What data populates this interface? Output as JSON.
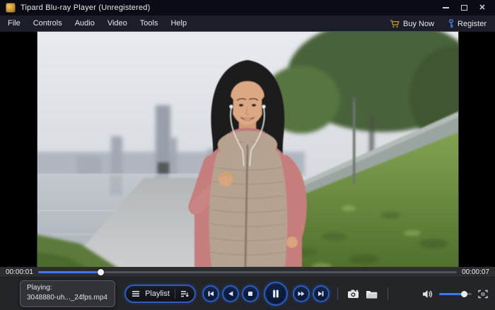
{
  "titlebar": {
    "title": "Tipard Blu-ray Player (Unregistered)"
  },
  "menubar": {
    "items": [
      "File",
      "Controls",
      "Audio",
      "Video",
      "Tools",
      "Help"
    ],
    "buy_now_label": "Buy Now",
    "register_label": "Register"
  },
  "video": {
    "description": "Woman jogging toward camera on a waterfront embankment path; hazy city skyline and tall tower across the water on the left, grassy slope with concrete retaining wall and trees on the right"
  },
  "player": {
    "current_time": "00:00:01",
    "total_time": "00:00:07",
    "progress_percent": 15,
    "volume_percent": 78
  },
  "playlist_button": {
    "label": "Playlist"
  },
  "now_playing": {
    "label": "Playing:",
    "filename": "3048880-uh..._24fps.mp4"
  },
  "icons": {
    "buy_now": "cart-icon",
    "register": "key-icon",
    "playlist_left": "menu-icon",
    "playlist_right": "play-order-icon",
    "transport": [
      "previous-icon",
      "rewind-icon",
      "stop-icon",
      "pause-icon",
      "fast-forward-icon",
      "next-icon"
    ],
    "tools": [
      "snapshot-camera-icon",
      "open-folder-icon"
    ],
    "right_side": [
      "volume-icon",
      "fullscreen-icon"
    ]
  },
  "colors": {
    "accent_blue": "#3a7bf0",
    "button_ring_blue": "#2c5cc0",
    "titlebar_bg": "#0a0c15",
    "menubar_bg": "#1b1e28",
    "controlbar_bg": "#242529",
    "cart_gold": "#c59335",
    "key_blue": "#4a79e8"
  }
}
